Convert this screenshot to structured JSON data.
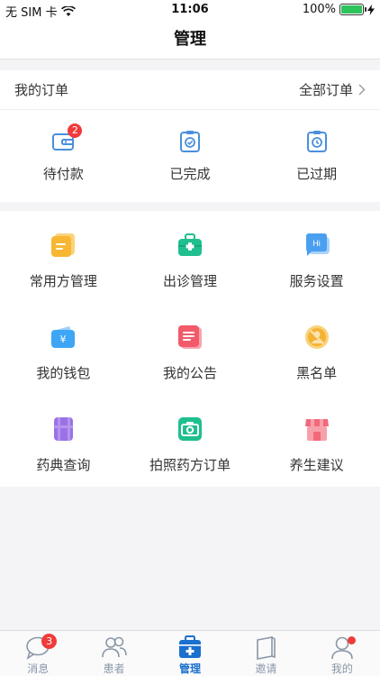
{
  "status_bar": {
    "carrier": "无 SIM 卡",
    "time": "11:06",
    "battery": "100%",
    "battery_level": 1.0
  },
  "nav": {
    "title": "管理"
  },
  "orders": {
    "title": "我的订单",
    "all_label": "全部订单",
    "items": [
      {
        "label": "待付款",
        "badge": "2",
        "icon": "wallet-icon"
      },
      {
        "label": "已完成",
        "icon": "clipboard-check-icon"
      },
      {
        "label": "已过期",
        "icon": "clipboard-clock-icon"
      }
    ]
  },
  "management": {
    "items": [
      {
        "label": "常用方管理",
        "icon": "prescription-icon",
        "color": "#f7b733"
      },
      {
        "label": "出诊管理",
        "icon": "medical-kit-icon",
        "color": "#1fbf8f"
      },
      {
        "label": "服务设置",
        "icon": "chat-hi-icon",
        "color": "#4a9ff0"
      },
      {
        "label": "我的钱包",
        "icon": "wallet-yuan-icon",
        "color": "#3ea6f5"
      },
      {
        "label": "我的公告",
        "icon": "notice-icon",
        "color": "#f25a6a"
      },
      {
        "label": "黑名单",
        "icon": "blacklist-icon",
        "color": "#f5b335"
      },
      {
        "label": "药典查询",
        "icon": "book-icon",
        "color": "#9b72e6"
      },
      {
        "label": "拍照药方订单",
        "icon": "camera-icon",
        "color": "#1fbf8f"
      },
      {
        "label": "养生建议",
        "icon": "shop-icon",
        "color": "#f06a7a"
      }
    ]
  },
  "tabs": [
    {
      "label": "消息",
      "icon": "chat-bubble-icon",
      "badge": "3"
    },
    {
      "label": "患者",
      "icon": "users-icon"
    },
    {
      "label": "管理",
      "icon": "medical-box-icon",
      "active": true
    },
    {
      "label": "邀请",
      "icon": "invite-book-icon"
    },
    {
      "label": "我的",
      "icon": "person-icon",
      "dot": true
    }
  ],
  "colors": {
    "accent": "#1a6fcf",
    "tab_inactive": "#8a97a8",
    "badge": "#f03b3b"
  }
}
